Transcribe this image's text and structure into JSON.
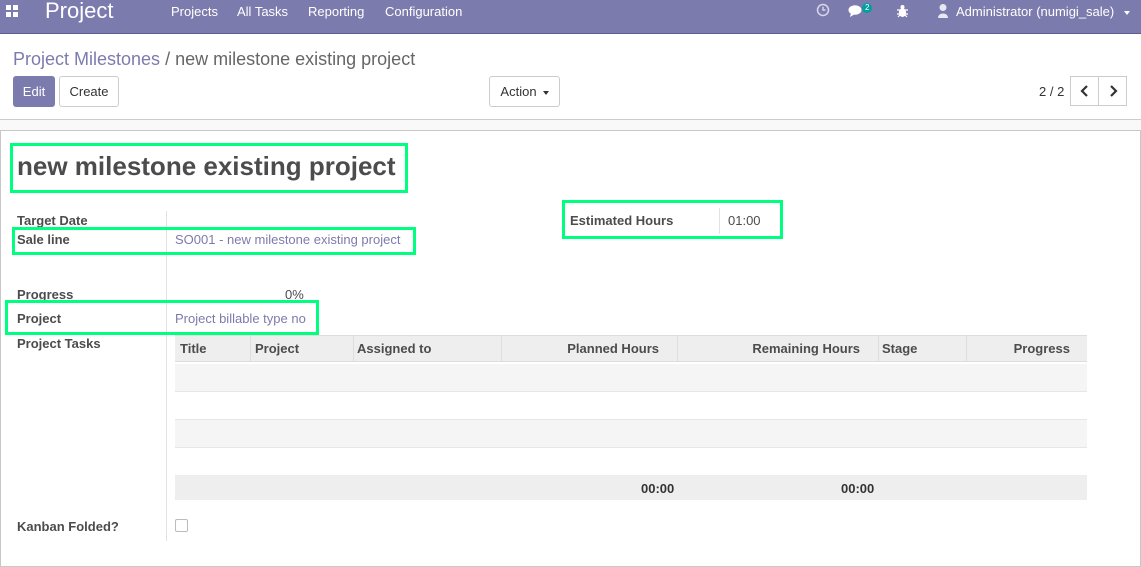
{
  "navbar": {
    "brand": "Project",
    "menu": [
      "Projects",
      "All Tasks",
      "Reporting",
      "Configuration"
    ],
    "message_count": "2",
    "user": "Administrator (numigi_sale)"
  },
  "breadcrumb": {
    "parent": "Project Milestones",
    "separator": "/",
    "current": "new milestone existing project"
  },
  "buttons": {
    "edit": "Edit",
    "create": "Create",
    "action": "Action"
  },
  "pager": {
    "value": "2 / 2"
  },
  "form": {
    "title": "new milestone existing project",
    "target_date_label": "Target Date",
    "target_date": "",
    "sale_line_label": "Sale line",
    "sale_line": "SO001 - new milestone existing project",
    "estimated_hours_label": "Estimated Hours",
    "estimated_hours": "01:00",
    "progress_label": "Progress",
    "progress": "0%",
    "project_label": "Project",
    "project": "Project billable type no",
    "tasks_label": "Project Tasks",
    "kanban_folded_label": "Kanban Folded?"
  },
  "tasks_table": {
    "columns": [
      "Title",
      "Project",
      "Assigned to",
      "Planned Hours",
      "Remaining Hours",
      "Stage",
      "Progress"
    ],
    "rows": [],
    "totals": {
      "planned_hours": "00:00",
      "remaining_hours": "00:00"
    }
  },
  "colors": {
    "brand": "#7c7bad",
    "highlight": "#00ff7f",
    "badge": "#00a09d"
  }
}
